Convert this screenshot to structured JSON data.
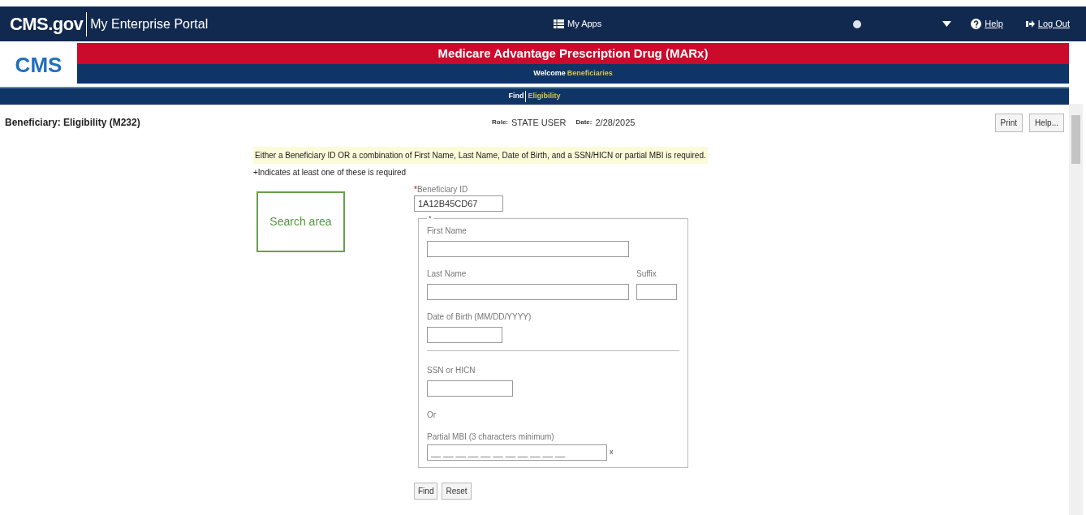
{
  "portal_bar": {
    "brand": "CMS.gov",
    "portal": "My Enterprise Portal",
    "apps": "My Apps",
    "help": "Help",
    "logout": "Log Out"
  },
  "app_header": {
    "logo": "CMS",
    "title": "Medicare Advantage Prescription Drug (MARx)",
    "welcome_label": "Welcome",
    "welcome_link": "Beneficiaries",
    "find_label": "Find",
    "find_link": "Eligibility"
  },
  "page": {
    "title": "Beneficiary: Eligibility (M232)",
    "role_label": "Role:",
    "role": "STATE USER",
    "date_label": "Date:",
    "date": "2/28/2025",
    "buttons": [
      "Print",
      "Help..."
    ]
  },
  "notice": "Either a Beneficiary ID OR a combination of First Name, Last Name, Date of Birth, and a SSN/HICN or partial MBI is required.",
  "required_note": "+Indicates at least one of these is required",
  "search_area_label": "Search area",
  "form": {
    "beneficiary_id": {
      "label": "Beneficiary ID",
      "required_mark": "*",
      "value": "1A12B45CD67"
    },
    "group_mark": "*",
    "first_name": {
      "label": "First Name"
    },
    "last_name": {
      "label": "Last Name"
    },
    "suffix": {
      "label": "Suffix"
    },
    "dob": {
      "label": "Date of Birth (MM/DD/YYYY)"
    },
    "ssn": {
      "label": "SSN or HICN"
    },
    "or": "Or",
    "mbi": {
      "label": "Partial MBI (3 characters minimum)",
      "placeholder": "__ __ __ __ __ __ __ __ __ __ __",
      "clear": "x"
    }
  },
  "actions": [
    "Find",
    "Reset"
  ]
}
